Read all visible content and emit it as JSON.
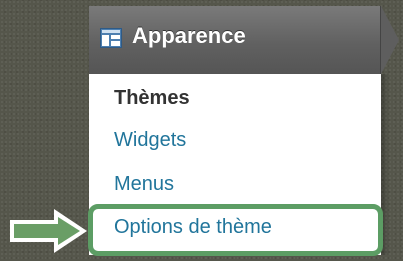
{
  "menu": {
    "header_label": "Apparence",
    "header_icon": "appearance-icon",
    "items": [
      {
        "label": "Thèmes",
        "current": true
      },
      {
        "label": "Widgets",
        "current": false
      },
      {
        "label": "Menus",
        "current": false
      },
      {
        "label": "Options de thème",
        "current": false
      }
    ]
  },
  "annotation": {
    "arrow_icon": "right-arrow-icon",
    "highlight_color": "#5c9d64",
    "arrow_fill": "#6a9e66"
  },
  "colors": {
    "link": "#21759b",
    "current_item": "#333333",
    "header_text": "#ffffff"
  }
}
